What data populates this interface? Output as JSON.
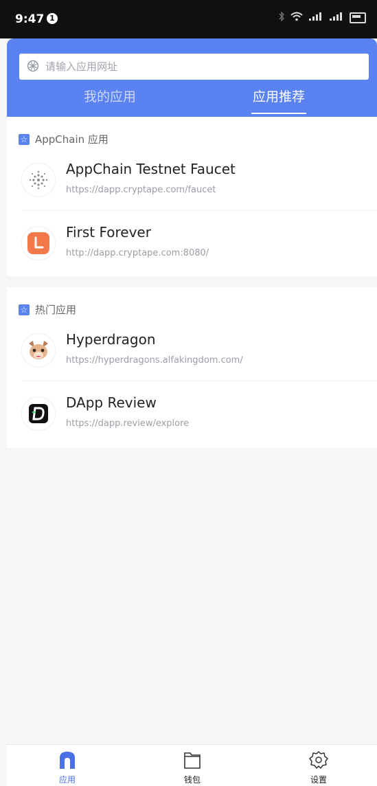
{
  "status_bar": {
    "time": "9:47",
    "notification_badge": "1",
    "bluetooth_icon": "bluetooth-icon",
    "wifi_icon": "wifi-icon",
    "signal_icon": "signal-icon",
    "battery_icon": "battery-icon"
  },
  "header": {
    "background_color": "#5a82f0",
    "search": {
      "placeholder": "请输入应用网址",
      "value": "",
      "icon": "globe-icon"
    },
    "tabs": [
      {
        "label": "我的应用",
        "active": false
      },
      {
        "label": "应用推荐",
        "active": true
      }
    ]
  },
  "sections": [
    {
      "title": "AppChain 应用",
      "icon": "star-icon",
      "apps": [
        {
          "name": "AppChain Testnet Faucet",
          "url": "https://dapp.cryptape.com/faucet",
          "icon": "faucet-logo-icon"
        },
        {
          "name": "First Forever",
          "url": "http://dapp.cryptape.com:8080/",
          "icon": "first-forever-logo-icon"
        }
      ]
    },
    {
      "title": "热门应用",
      "icon": "star-icon",
      "apps": [
        {
          "name": "Hyperdragon",
          "url": "https://hyperdragons.alfakingdom.com/",
          "icon": "hyperdragon-logo-icon"
        },
        {
          "name": "DApp Review",
          "url": "https://dapp.review/explore",
          "icon": "dapp-review-logo-icon"
        }
      ]
    }
  ],
  "bottom_nav": [
    {
      "label": "应用",
      "icon": "home-icon",
      "active": true
    },
    {
      "label": "钱包",
      "icon": "wallet-icon",
      "active": false
    },
    {
      "label": "设置",
      "icon": "settings-gear-icon",
      "active": false
    }
  ],
  "colors": {
    "accent": "#5a82f0",
    "active_nav": "#4a6fe6"
  }
}
